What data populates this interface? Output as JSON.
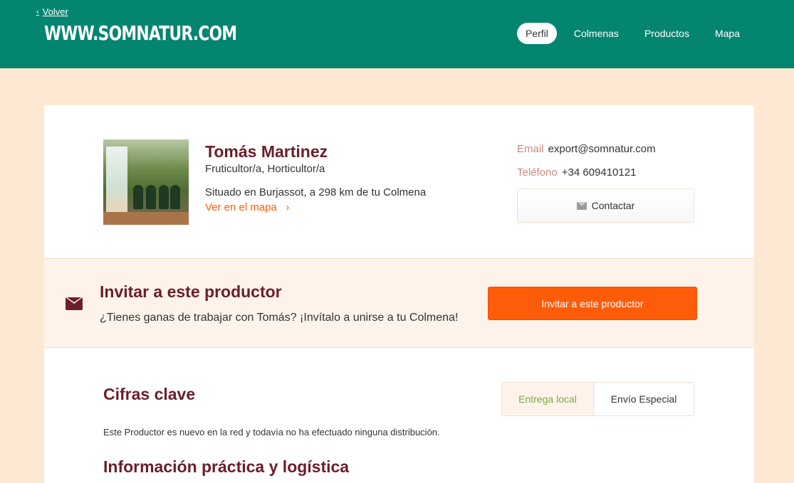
{
  "header": {
    "back_label": "Volver",
    "logo_text": "WWW.SOMNATUR.COM",
    "nav": [
      {
        "label": "Perfil",
        "active": true
      },
      {
        "label": "Colmenas",
        "active": false
      },
      {
        "label": "Productos",
        "active": false
      },
      {
        "label": "Mapa",
        "active": false
      }
    ]
  },
  "profile": {
    "name": "Tomás Martinez",
    "roles": "Fruticultor/a, Horticultor/a",
    "location": "Situado en Burjassot, a 298 km de tu Colmena",
    "map_link": "Ver en el mapa",
    "email_label": "Email",
    "email_value": "export@somnatur.com",
    "phone_label": "Teléfono",
    "phone_value": "+34 609410121",
    "contact_button": "Contactar"
  },
  "invite": {
    "title": "Invitar a este productor",
    "text": "¿Tienes ganas de trabajar con Tomás? ¡Invítalo a unirse a tu Colmena!",
    "button": "Invitar a este productor"
  },
  "stats": {
    "title": "Cifras clave",
    "toggle_left": "Entrega local",
    "toggle_right": "Envío Especial",
    "text": "Este Productor es nuevo en la red y todavía no ha efectuado ninguna distribución.",
    "info_title": "Información práctica y logística"
  },
  "colors": {
    "header_bg": "#03856f",
    "page_bg": "#fde8d3",
    "heading": "#6b1e2b",
    "accent": "#ff5c00",
    "green_text": "#7bab3f"
  }
}
